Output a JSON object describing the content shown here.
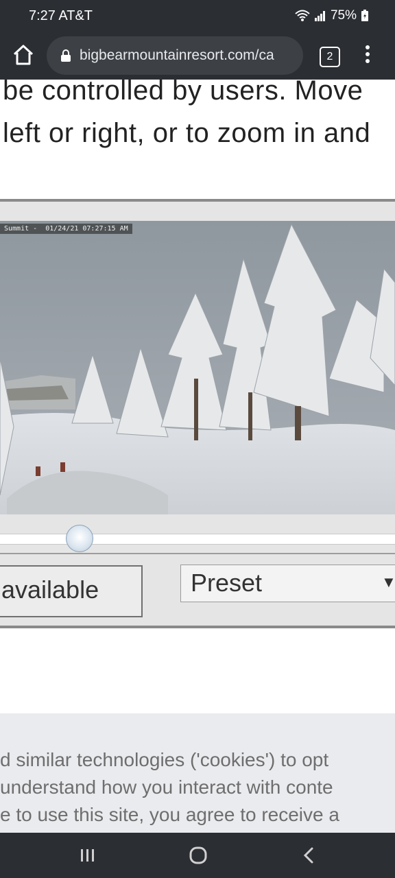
{
  "status_bar": {
    "time": "7:27 AT&T",
    "battery": "75%"
  },
  "browser": {
    "url": "bigbearmountainresort.com/ca",
    "tab_count": "2"
  },
  "intro": {
    "line1": "be controlled by users. Move",
    "line2": "left or right, or to zoom in and"
  },
  "webcam": {
    "caption": "Summit -  01/24/21 07:27:15 AM",
    "zoom_level": 0.2,
    "status_text": "available",
    "preset_label": "Preset"
  },
  "cookie_banner": {
    "line1": "d similar technologies ('cookies') to opt",
    "line2": "understand how you interact with conte",
    "line3": "e to use this site, you agree to receive a"
  },
  "icons": {
    "home": "home-icon",
    "lock": "lock-icon",
    "menu": "more-vert-icon",
    "recents": "recents-icon",
    "home_nav": "home-nav-icon",
    "back": "back-icon"
  }
}
